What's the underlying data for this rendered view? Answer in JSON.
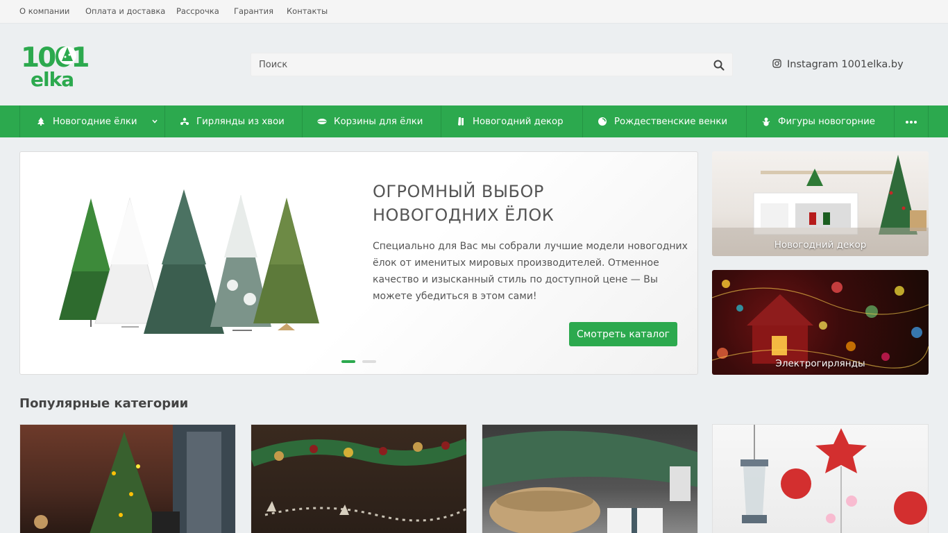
{
  "topbar": {
    "links": [
      "О компании",
      "Оплата и доставка",
      "Рассрочка",
      "Гарантия",
      "Контакты"
    ]
  },
  "header": {
    "logo_text_top": "1001",
    "logo_text_bottom": "elka",
    "search_placeholder": "Поиск",
    "instagram_label": "Instagram 1001elka.by"
  },
  "menu": {
    "items": [
      {
        "label": "Новогодние ёлки",
        "icon": "tree-icon",
        "has_dropdown": true
      },
      {
        "label": "Гирлянды из хвои",
        "icon": "garland-icon"
      },
      {
        "label": "Корзины для ёлки",
        "icon": "basket-icon"
      },
      {
        "label": "Новогодний декор",
        "icon": "decor-icon"
      },
      {
        "label": "Рождественские венки",
        "icon": "wreath-icon"
      },
      {
        "label": "Фигуры новогорние",
        "icon": "snowman-icon"
      }
    ],
    "more_icon": "more-dots-icon"
  },
  "slider": {
    "title": "ОГРОМНЫЙ ВЫБОР НОВОГОДНИХ ЁЛОК",
    "text": "Специально для Вас мы собрали лучшие модели новогодних ёлок от именитых мировых производителей. Отменное качество и изысканный стиль по доступной цене — Вы можете убедиться в этом сами!",
    "button": "Смотреть каталог",
    "active_slide": 1,
    "slides_count": 2
  },
  "banners": [
    {
      "label": "Новогодний декор"
    },
    {
      "label": "Электрогирлянды"
    }
  ],
  "popular": {
    "title": "Популярные категории",
    "items": [
      "christmas-tree-room-image",
      "pine-garland-image",
      "tree-basket-image",
      "red-ornaments-image"
    ]
  },
  "colors": {
    "brand_green": "#2ca94e",
    "background": "#eceff1"
  }
}
